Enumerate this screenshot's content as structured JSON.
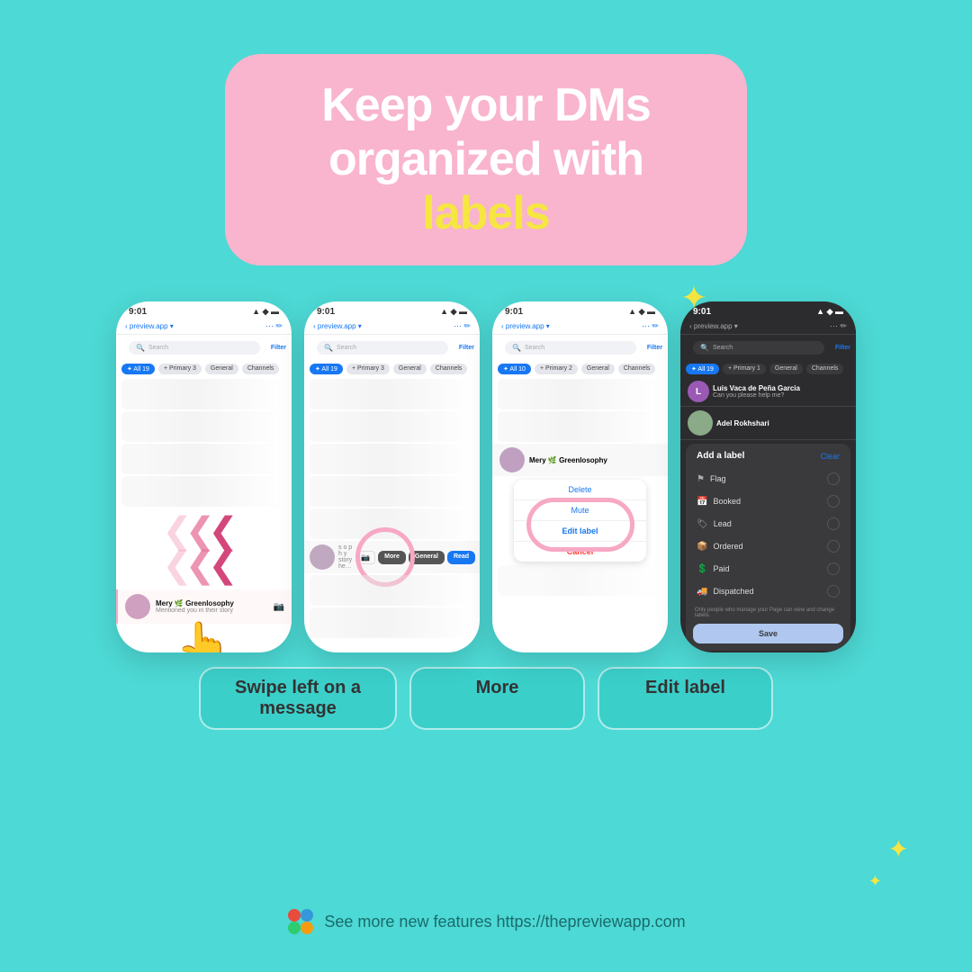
{
  "header": {
    "title_line1": "Keep your DMs",
    "title_line2": "organized with ",
    "title_highlight": "labels",
    "bg_color": "#f7a8c4"
  },
  "phones": [
    {
      "id": "phone1",
      "theme": "light",
      "time": "9:01",
      "app": "preview.app",
      "tabs": [
        "All 19",
        "Primary 3",
        "General",
        "Channels"
      ],
      "active_tab": "All 19",
      "has_chevrons": true,
      "has_hand": true,
      "step_label": "Swipe left on a message"
    },
    {
      "id": "phone2",
      "theme": "light",
      "time": "9:01",
      "app": "preview.app",
      "tabs": [
        "All 19",
        "Primary 3",
        "General",
        "Channels"
      ],
      "active_tab": "All 19",
      "has_circle": true,
      "swipe_buttons": [
        "More",
        "General",
        "Read"
      ],
      "step_label": "More"
    },
    {
      "id": "phone3",
      "theme": "light",
      "time": "9:01",
      "app": "preview.app",
      "tabs": [
        "All 10",
        "Primary 2",
        "General",
        "Channels"
      ],
      "active_tab": "All 10",
      "context_items": [
        "Delete",
        "Mute",
        "Edit label",
        "Cancel"
      ],
      "step_label": "Edit label"
    },
    {
      "id": "phone4",
      "theme": "dark",
      "time": "9:01",
      "app": "preview.app",
      "tabs": [
        "All 19",
        "Primary 1",
        "General",
        "Channels"
      ],
      "active_tab": "All 19",
      "label_panel": {
        "title": "Add a label",
        "clear": "Clear",
        "items": [
          "Flag",
          "Booked",
          "Lead",
          "Ordered",
          "Paid",
          "Dispatched"
        ],
        "note": "Only people who manage your Page can view and change labels."
      },
      "step_label": ""
    }
  ],
  "footer": {
    "logo_colors": [
      "#e74c3c",
      "#3498db",
      "#2ecc71",
      "#f39c12"
    ],
    "text": "See more new features https://thepreviewapp.com"
  }
}
